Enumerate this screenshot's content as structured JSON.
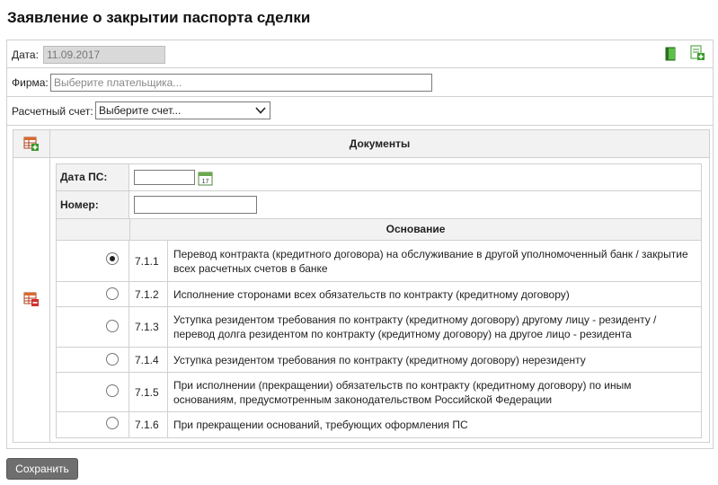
{
  "page": {
    "title": "Заявление о закрытии паспорта сделки"
  },
  "form": {
    "date_label": "Дата:",
    "date_value": "11.09.2017",
    "firm_label": "Фирма:",
    "firm_placeholder": "Выберите плательщика...",
    "account_label": "Расчетный счет:",
    "account_selected": "Выберите счет..."
  },
  "documents": {
    "header": "Документы",
    "ps_date_label": "Дата ПС:",
    "ps_date_value": "",
    "number_label": "Номер:",
    "number_value": "",
    "basis_header": "Основание",
    "options": [
      {
        "code": "7.1.1",
        "text": "Перевод контракта (кредитного договора) на обслуживание в другой уполномоченный банк / закрытие всех расчетных счетов в банке",
        "selected": true
      },
      {
        "code": "7.1.2",
        "text": "Исполнение сторонами всех обязательств по контракту (кредитному договору)",
        "selected": false
      },
      {
        "code": "7.1.3",
        "text": "Уступка резидентом требования по контракту (кредитному договору) другому лицу - резиденту / перевод долга резидентом по контракту (кредитному договору) на другое лицо - резидента",
        "selected": false
      },
      {
        "code": "7.1.4",
        "text": "Уступка резидентом требования по контракту (кредитному договору) нерезиденту",
        "selected": false
      },
      {
        "code": "7.1.5",
        "text": "При исполнении (прекращении) обязательств по контракту (кредитному договору) по иным основаниям, предусмотренным законодательством Российской Федерации",
        "selected": false
      },
      {
        "code": "7.1.6",
        "text": "При прекращении оснований, требующих оформления ПС",
        "selected": false
      }
    ]
  },
  "actions": {
    "save_label": "Сохранить"
  },
  "icons": {
    "book": "book-icon",
    "add_document": "add-document-icon",
    "add_row": "add-row-icon",
    "delete_row": "delete-row-icon",
    "calendar": "calendar-icon",
    "chevron": "chevron-down-icon"
  },
  "colors": {
    "header_bg": "#f2f2f2",
    "border": "#d0d0d0",
    "save_button": "#6e6e6e",
    "icon_green": "#3c9a2e"
  }
}
